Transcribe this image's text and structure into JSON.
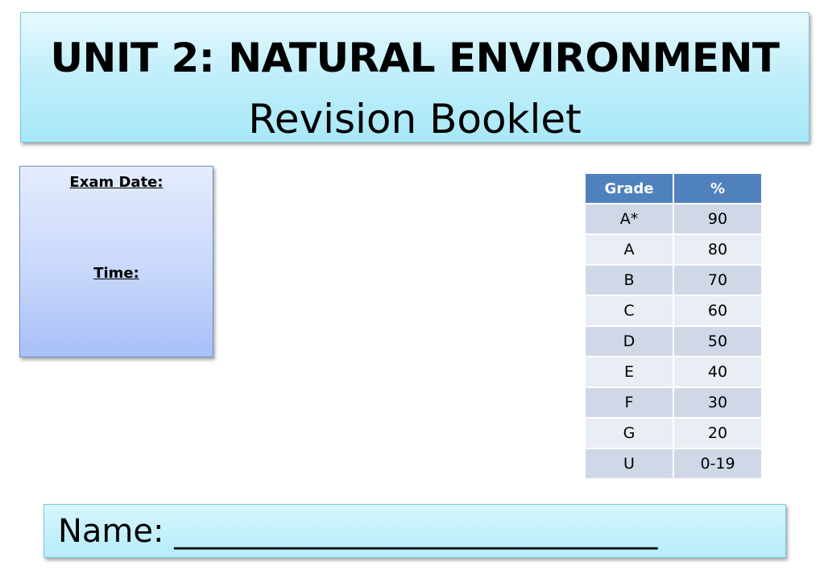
{
  "header": {
    "title": "UNIT 2: NATURAL ENVIRONMENT",
    "subtitle": "Revision Booklet"
  },
  "exam_info": {
    "date_label": "Exam Date:",
    "time_label": "Time:"
  },
  "grade_table": {
    "headers": [
      "Grade",
      "%"
    ],
    "rows": [
      [
        "A*",
        "90"
      ],
      [
        "A",
        "80"
      ],
      [
        "B",
        "70"
      ],
      [
        "C",
        "60"
      ],
      [
        "D",
        "50"
      ],
      [
        "E",
        "40"
      ],
      [
        "F",
        "30"
      ],
      [
        "G",
        "20"
      ],
      [
        "U",
        "0-19"
      ]
    ],
    "header_color": "#4f81bd"
  },
  "name_field": {
    "text": "Name: ______________________________"
  }
}
